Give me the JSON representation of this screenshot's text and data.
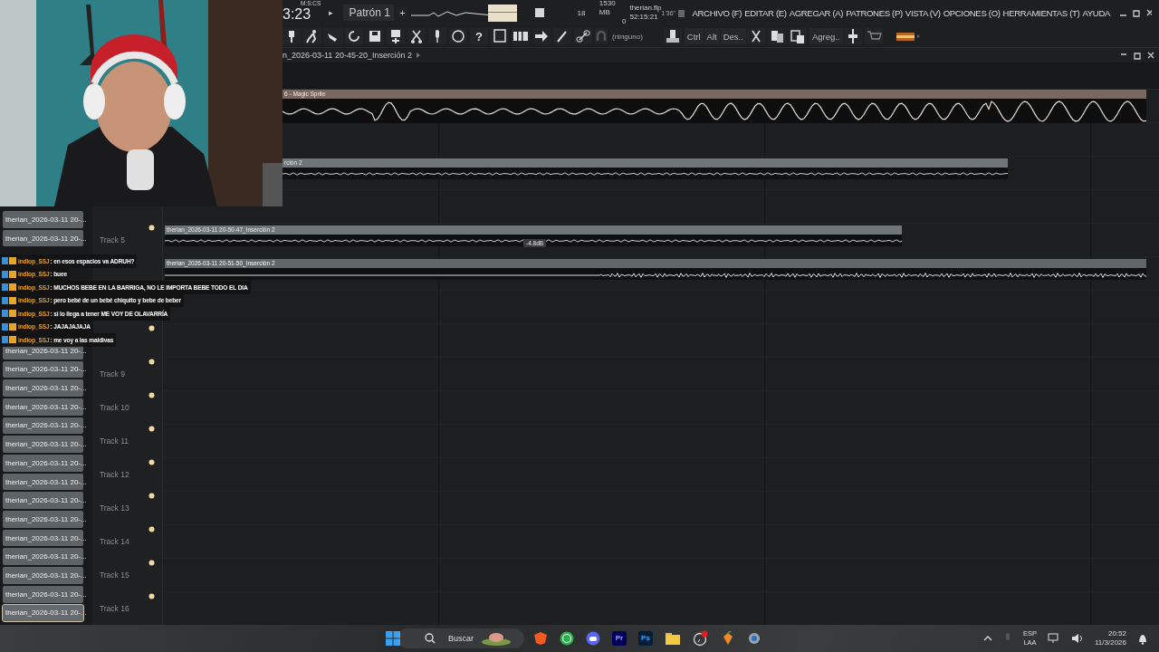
{
  "header": {
    "time_label": "M:S:CS",
    "time": "3:23",
    "play": "▸",
    "pattern": "Patrón 1",
    "add": "+",
    "cpu": "18",
    "memory": "1530 MB",
    "polyphony": "0",
    "file": "therian.flp",
    "elapsed": "52:15:21",
    "duration": "1'36\"",
    "menu": [
      "ARCHIVO (F)",
      "EDITAR (E)",
      "AGREGAR (A)",
      "PATRONES (P)",
      "VISTA (V)",
      "OPCIONES (O)",
      "HERRAMIENTAS (T)",
      "AYUDA"
    ]
  },
  "toolbar": {
    "help": "?",
    "snap": "(ninguno)",
    "keys": [
      "Ctrl",
      "Alt",
      "Des.."
    ],
    "add": "Agreg.."
  },
  "breadcrumb": "n_2026-03-11 20-45-20_Inserción 2",
  "clip_list": [
    {
      "label": "therian_2026-03-11 20-...",
      "selected": false,
      "gap_before": false
    },
    {
      "label": "therian_2026-03-11 20-...",
      "selected": false,
      "gap_before": false
    },
    {
      "label": "therian_2026-03-11 20-...",
      "selected": false,
      "gap_before": true
    },
    {
      "label": "therian_2026-03-11 20-...",
      "selected": false,
      "gap_before": false
    },
    {
      "label": "therian_2026-03-11 20-...",
      "selected": false,
      "gap_before": false
    },
    {
      "label": "therian_2026-03-11 20-...",
      "selected": false,
      "gap_before": false
    },
    {
      "label": "therian_2026-03-11 20-...",
      "selected": false,
      "gap_before": false
    },
    {
      "label": "therian_2026-03-11 20-...",
      "selected": false,
      "gap_before": false
    },
    {
      "label": "therian_2026-03-11 20-...",
      "selected": false,
      "gap_before": false
    },
    {
      "label": "therian_2026-03-11 20-...",
      "selected": false,
      "gap_before": false
    },
    {
      "label": "therian_2026-03-11 20-...",
      "selected": false,
      "gap_before": false
    },
    {
      "label": "therian_2026-03-11 20-...",
      "selected": false,
      "gap_before": false
    },
    {
      "label": "therian_2026-03-11 20-...",
      "selected": false,
      "gap_before": false
    },
    {
      "label": "therian_2026-03-11 20-...",
      "selected": false,
      "gap_before": false
    },
    {
      "label": "therian_2026-03-11 20-...",
      "selected": false,
      "gap_before": false
    },
    {
      "label": "therian_2026-03-11 20-...",
      "selected": false,
      "gap_before": false
    },
    {
      "label": "therian_2026-03-11 20-...",
      "selected": true,
      "gap_before": false
    }
  ],
  "tracks": [
    {
      "kind": "clip",
      "clip": {
        "title": "6 - Magic Sprite",
        "kind": "wave"
      }
    },
    {
      "kind": "empty"
    },
    {
      "kind": "clip",
      "clip": {
        "title": "rción 2",
        "kind": "flat"
      }
    },
    {
      "kind": "empty"
    },
    {
      "kind": "clip",
      "label": "Track 5",
      "clip": {
        "title": "therian_2026-03-11 20-50-47_Inserción 2",
        "kind": "flat",
        "marker": "-4.8dB"
      }
    },
    {
      "kind": "clip",
      "clip": {
        "title": "therian_2026-03-11 20-51-50_Inserción 2",
        "kind": "noise"
      }
    },
    {
      "kind": "empty"
    },
    {
      "kind": "empty"
    },
    {
      "kind": "empty",
      "label": "Track 9"
    },
    {
      "kind": "empty",
      "label": "Track 10"
    },
    {
      "kind": "empty",
      "label": "Track 11"
    },
    {
      "kind": "empty",
      "label": "Track 12"
    },
    {
      "kind": "empty",
      "label": "Track 13"
    },
    {
      "kind": "empty",
      "label": "Track 14"
    },
    {
      "kind": "empty",
      "label": "Track 15"
    },
    {
      "kind": "empty",
      "label": "Track 16"
    }
  ],
  "chat": [
    {
      "user": "indiop_SSJ",
      "message": ": en esos espacios va ADRUH?"
    },
    {
      "user": "indiop_SSJ",
      "message": ": buee"
    },
    {
      "user": "indiop_SSJ",
      "message": ": MUCHOS BEBE EN LA BARRIGA, NO LE IMPORTA BEBE TODO EL DIA"
    },
    {
      "user": "indiop_SSJ",
      "message": ": pero bebé de un bebé chiquito y bebe de beber"
    },
    {
      "user": "indiop_SSJ",
      "message": ": si lo llega a tener ME VOY DE OLAVARRÍA"
    },
    {
      "user": "indiop_SSJ",
      "message": ": JAJAJAJAJA"
    },
    {
      "user": "indiop_SSJ",
      "message": ": me voy a las maldivas"
    }
  ],
  "taskbar": {
    "search": "Buscar",
    "apps": [
      "Pr",
      "Ps"
    ],
    "language": "ESP",
    "layout": "LAA",
    "time": "20:52",
    "date": "11/3/2026"
  }
}
